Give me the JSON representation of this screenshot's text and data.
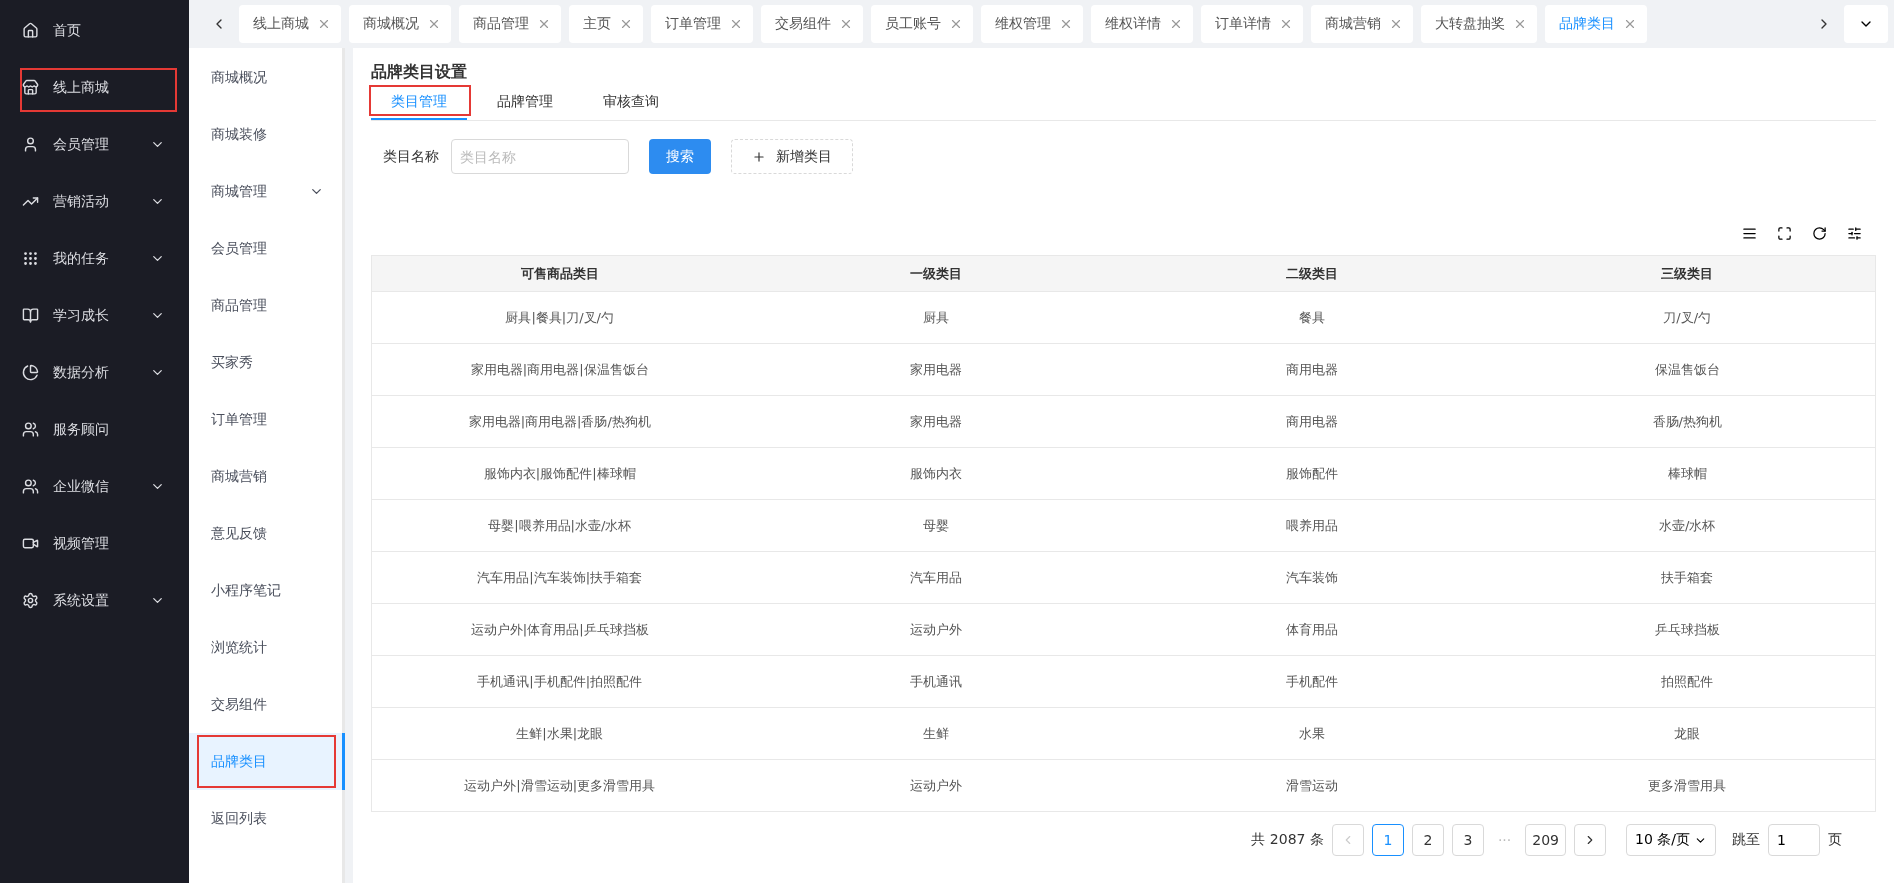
{
  "main_menu": [
    {
      "label": "首页",
      "expandable": false,
      "highlighted": false
    },
    {
      "label": "线上商城",
      "expandable": false,
      "highlighted": true
    },
    {
      "label": "会员管理",
      "expandable": true,
      "highlighted": false
    },
    {
      "label": "营销活动",
      "expandable": true,
      "highlighted": false
    },
    {
      "label": "我的任务",
      "expandable": true,
      "highlighted": false
    },
    {
      "label": "学习成长",
      "expandable": true,
      "highlighted": false
    },
    {
      "label": "数据分析",
      "expandable": true,
      "highlighted": false
    },
    {
      "label": "服务顾问",
      "expandable": false,
      "highlighted": false
    },
    {
      "label": "企业微信",
      "expandable": true,
      "highlighted": false
    },
    {
      "label": "视频管理",
      "expandable": false,
      "highlighted": false
    },
    {
      "label": "系统设置",
      "expandable": true,
      "highlighted": false
    }
  ],
  "sub_menu": [
    {
      "label": "商城概况",
      "expandable": false,
      "selected": false
    },
    {
      "label": "商城装修",
      "expandable": false,
      "selected": false
    },
    {
      "label": "商城管理",
      "expandable": true,
      "selected": false
    },
    {
      "label": "会员管理",
      "expandable": false,
      "selected": false
    },
    {
      "label": "商品管理",
      "expandable": false,
      "selected": false
    },
    {
      "label": "买家秀",
      "expandable": false,
      "selected": false
    },
    {
      "label": "订单管理",
      "expandable": false,
      "selected": false
    },
    {
      "label": "商城营销",
      "expandable": false,
      "selected": false
    },
    {
      "label": "意见反馈",
      "expandable": false,
      "selected": false
    },
    {
      "label": "小程序笔记",
      "expandable": false,
      "selected": false
    },
    {
      "label": "浏览统计",
      "expandable": false,
      "selected": false
    },
    {
      "label": "交易组件",
      "expandable": false,
      "selected": false
    },
    {
      "label": "品牌类目",
      "expandable": false,
      "selected": true
    },
    {
      "label": "返回列表",
      "expandable": false,
      "selected": false
    }
  ],
  "page_tabs": [
    {
      "label": "线上商城",
      "selected": false
    },
    {
      "label": "商城概况",
      "selected": false
    },
    {
      "label": "商品管理",
      "selected": false
    },
    {
      "label": "主页",
      "selected": false
    },
    {
      "label": "订单管理",
      "selected": false
    },
    {
      "label": "交易组件",
      "selected": false
    },
    {
      "label": "员工账号",
      "selected": false
    },
    {
      "label": "维权管理",
      "selected": false
    },
    {
      "label": "维权详情",
      "selected": false
    },
    {
      "label": "订单详情",
      "selected": false
    },
    {
      "label": "商城营销",
      "selected": false
    },
    {
      "label": "大转盘抽奖",
      "selected": false
    },
    {
      "label": "品牌类目",
      "selected": true
    }
  ],
  "page_title": "品牌类目设置",
  "content_tabs": [
    {
      "label": "类目管理",
      "selected": true
    },
    {
      "label": "品牌管理",
      "selected": false
    },
    {
      "label": "审核查询",
      "selected": false
    }
  ],
  "filter": {
    "label": "类目名称",
    "placeholder": "类目名称",
    "search_button": "搜索",
    "add_button": "新增类目"
  },
  "table": {
    "columns": [
      "可售商品类目",
      "一级类目",
      "二级类目",
      "三级类目"
    ],
    "rows": [
      [
        "厨具|餐具|刀/叉/勺",
        "厨具",
        "餐具",
        "刀/叉/勺"
      ],
      [
        "家用电器|商用电器|保温售饭台",
        "家用电器",
        "商用电器",
        "保温售饭台"
      ],
      [
        "家用电器|商用电器|香肠/热狗机",
        "家用电器",
        "商用电器",
        "香肠/热狗机"
      ],
      [
        "服饰内衣|服饰配件|棒球帽",
        "服饰内衣",
        "服饰配件",
        "棒球帽"
      ],
      [
        "母婴|喂养用品|水壶/水杯",
        "母婴",
        "喂养用品",
        "水壶/水杯"
      ],
      [
        "汽车用品|汽车装饰|扶手箱套",
        "汽车用品",
        "汽车装饰",
        "扶手箱套"
      ],
      [
        "运动户外|体育用品|乒乓球挡板",
        "运动户外",
        "体育用品",
        "乒乓球挡板"
      ],
      [
        "手机通讯|手机配件|拍照配件",
        "手机通讯",
        "手机配件",
        "拍照配件"
      ],
      [
        "生鲜|水果|龙眼",
        "生鲜",
        "水果",
        "龙眼"
      ],
      [
        "运动户外|滑雪运动|更多滑雪用具",
        "运动户外",
        "滑雪运动",
        "更多滑雪用具"
      ]
    ]
  },
  "pagination": {
    "total": "共 2087 条",
    "pages": [
      {
        "label": "1",
        "selected": true
      },
      {
        "label": "2",
        "selected": false
      },
      {
        "label": "3",
        "selected": false
      },
      {
        "label": "209",
        "selected": false
      }
    ],
    "ellipsis": "···",
    "page_size": "10 条/页",
    "jump_label": "跳至",
    "jump_value": "1",
    "page_unit": "页"
  }
}
